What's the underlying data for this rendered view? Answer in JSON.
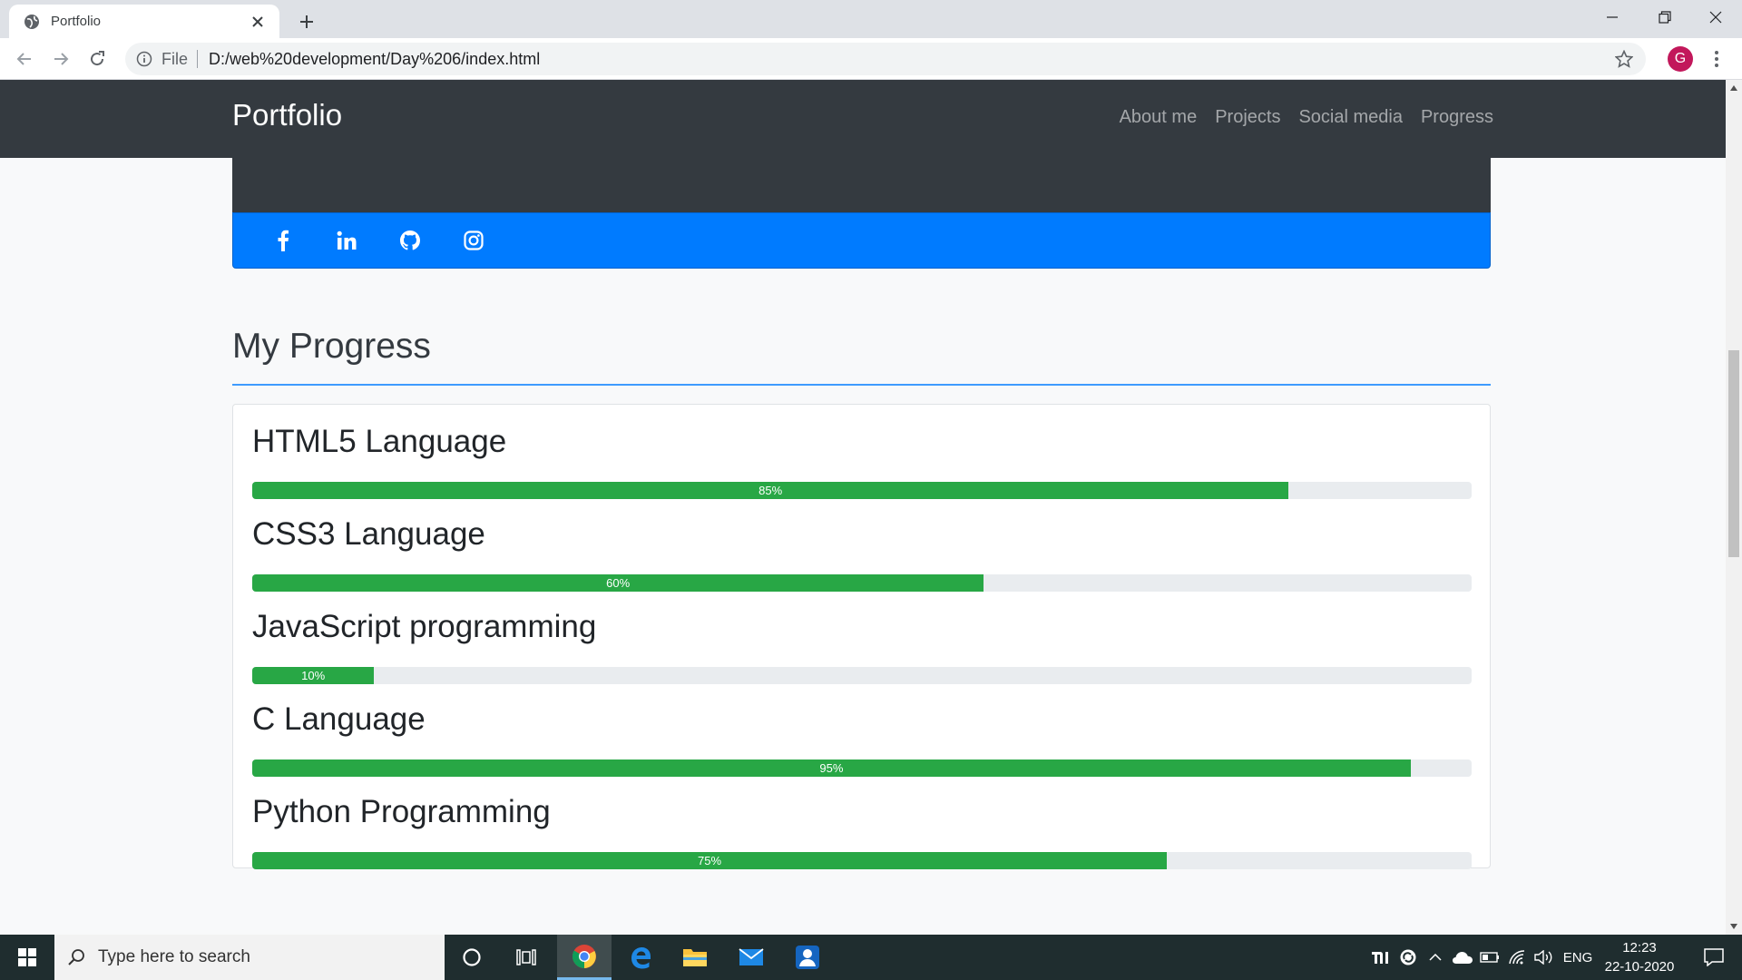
{
  "browser": {
    "tab_title": "Portfolio",
    "omnibox_scheme": "File",
    "url": "D:/web%20development/Day%206/index.html",
    "profile_initial": "G"
  },
  "site": {
    "brand": "Portfolio",
    "nav": [
      "About me",
      "Projects",
      "Social media",
      "Progress"
    ],
    "social_icons": [
      "facebook-icon",
      "linkedin-icon",
      "github-icon",
      "instagram-icon"
    ],
    "section_title": "My Progress",
    "skills": [
      {
        "name": "HTML5 Language",
        "percent": 85,
        "label": "85%"
      },
      {
        "name": "CSS3 Language",
        "percent": 60,
        "label": "60%"
      },
      {
        "name": "JavaScript programming",
        "percent": 10,
        "label": "10%"
      },
      {
        "name": "C Language",
        "percent": 95,
        "label": "95%"
      },
      {
        "name": "Python Programming",
        "percent": 75,
        "label": "75%"
      }
    ],
    "colors": {
      "navbar": "#343a40",
      "primary": "#007bff",
      "success": "#28a745"
    }
  },
  "taskbar": {
    "search_placeholder": "Type here to search",
    "language": "ENG",
    "time": "12:23",
    "date": "22-10-2020"
  }
}
